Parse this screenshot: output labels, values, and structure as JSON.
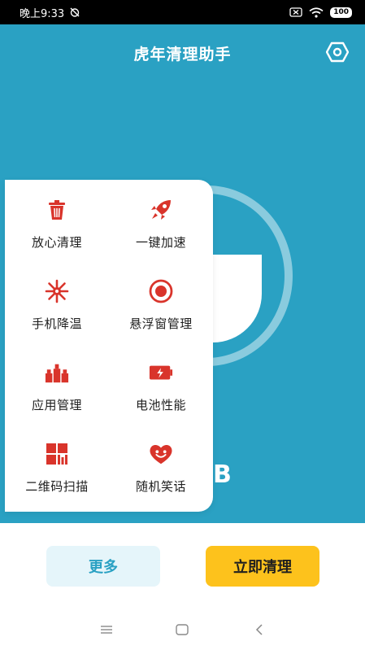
{
  "status_bar": {
    "time": "晚上9:33",
    "battery": "100",
    "icons": [
      "alarm-off-icon",
      "sim-error-icon",
      "wifi-icon",
      "battery-icon"
    ]
  },
  "header": {
    "title": "虎年清理助手",
    "settings_icon": "hexagon-settings-icon"
  },
  "storage": {
    "unit": "B"
  },
  "menu": {
    "items": [
      {
        "label": "放心清理",
        "icon": "trash-icon"
      },
      {
        "label": "一键加速",
        "icon": "rocket-icon"
      },
      {
        "label": "手机降温",
        "icon": "snowflake-icon"
      },
      {
        "label": "悬浮窗管理",
        "icon": "floating-window-icon"
      },
      {
        "label": "应用管理",
        "icon": "app-manage-icon"
      },
      {
        "label": "电池性能",
        "icon": "battery-performance-icon"
      },
      {
        "label": "二维码扫描",
        "icon": "qr-scan-icon"
      },
      {
        "label": "随机笑话",
        "icon": "heart-joke-icon"
      }
    ]
  },
  "actions": {
    "more_label": "更多",
    "clean_label": "立即清理"
  },
  "nav": {
    "icons": [
      "menu-icon",
      "home-icon",
      "back-icon"
    ]
  },
  "colors": {
    "primary": "#2aa1c3",
    "accent_red": "#d9342b",
    "button_yellow": "#fdc21c",
    "button_light": "#e5f5fa"
  }
}
